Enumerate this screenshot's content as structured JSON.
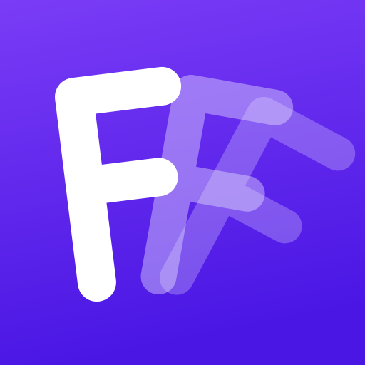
{
  "app_icon": {
    "letter": "F",
    "icon_name": "stacked-f-letters-logo",
    "colors": {
      "background_top": "#7c3cf6",
      "background_bottom": "#4d18e6",
      "glyph_front": "#ffffff",
      "glyph_ghost": "#d9ccff"
    }
  }
}
